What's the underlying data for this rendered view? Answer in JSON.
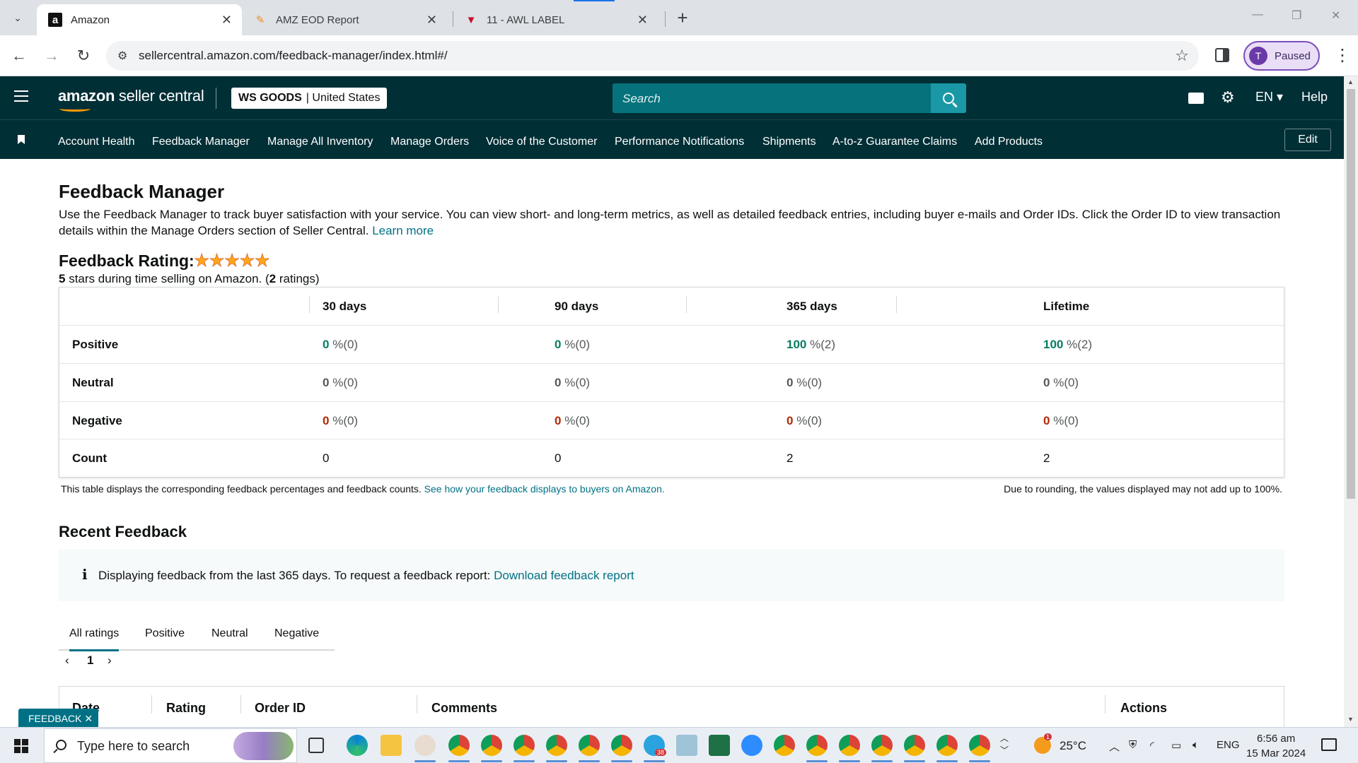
{
  "browser": {
    "tabs": [
      {
        "title": "Amazon",
        "favicon": "amazon-a",
        "active": true
      },
      {
        "title": "AMZ EOD Report",
        "favicon": "pencil-docs",
        "active": false
      },
      {
        "title": "11 - AWL LABEL",
        "favicon": "red-triangle",
        "active": false
      }
    ],
    "url": "sellercentral.amazon.com/feedback-manager/index.html#/",
    "profile_initial": "T",
    "profile_status": "Paused"
  },
  "header": {
    "logo_brand": "amazon",
    "logo_suffix": " seller central",
    "store_name": "WS GOODS",
    "store_region": "| United States",
    "search_placeholder": "Search",
    "language": "EN",
    "help": "Help"
  },
  "nav": {
    "items": [
      "Account Health",
      "Feedback Manager",
      "Manage All Inventory",
      "Manage Orders",
      "Voice of the Customer",
      "Performance Notifications",
      "Shipments",
      "A-to-z Guarantee Claims",
      "Add Products"
    ],
    "edit": "Edit"
  },
  "page": {
    "title": "Feedback Manager",
    "description": "Use the Feedback Manager to track buyer satisfaction with your service. You can view short- and long-term metrics, as well as detailed feedback entries, including buyer e-mails and Order IDs. Click the Order ID to view transaction details within the Manage Orders section of Seller Central.",
    "learn_more": "Learn more",
    "rating_title": "Feedback Rating:",
    "stars": "★★★★★",
    "rating_value": "5",
    "rating_text": " stars during time selling on Amazon. (",
    "rating_count": "2",
    "rating_count_suffix": " ratings)"
  },
  "metrics": {
    "columns": [
      "30 days",
      "90 days",
      "365 days",
      "Lifetime"
    ],
    "rows": [
      {
        "label": "Positive",
        "values": [
          "0",
          "0",
          "100",
          "100"
        ],
        "counts": [
          "%(0)",
          "%(0)",
          "%(2)",
          "%(2)"
        ]
      },
      {
        "label": "Neutral",
        "values": [
          "0",
          "0",
          "0",
          "0"
        ],
        "counts": [
          "%(0)",
          "%(0)",
          "%(0)",
          "%(0)"
        ]
      },
      {
        "label": "Negative",
        "values": [
          "0",
          "0",
          "0",
          "0"
        ],
        "counts": [
          "%(0)",
          "%(0)",
          "%(0)",
          "%(0)"
        ]
      },
      {
        "label": "Count",
        "values": [
          "0",
          "0",
          "2",
          "2"
        ]
      }
    ],
    "note": "This table displays the corresponding feedback percentages and feedback counts.",
    "note_link": "See how your feedback displays to buyers on Amazon.",
    "rounding_note": "Due to rounding, the values displayed may not add up to 100%."
  },
  "recent": {
    "title": "Recent Feedback",
    "info_icon": "i",
    "info_text": "Displaying feedback from the last 365 days. To request a feedback report:",
    "info_link": "Download feedback report",
    "tabs": [
      "All ratings",
      "Positive",
      "Neutral",
      "Negative"
    ],
    "page": "1",
    "columns": [
      "Date",
      "Rating",
      "Order ID",
      "Comments",
      "Actions"
    ],
    "feedback_tag": "FEEDBACK ✕"
  },
  "taskbar": {
    "search_placeholder": "Type here to search",
    "badge": "38",
    "weather_badge": "1",
    "temperature": "25°C",
    "lang": "ENG",
    "time": "6:56 am",
    "date": "15 Mar 2024"
  },
  "colors": {
    "header_bg": "#002f36",
    "link": "#007185",
    "positive": "#067d62",
    "negative": "#b12704",
    "star": "#ffa41c"
  }
}
